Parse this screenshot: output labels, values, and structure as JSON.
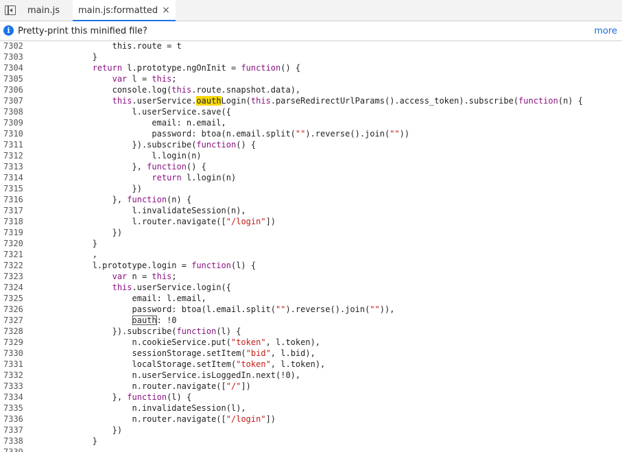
{
  "tabs": [
    {
      "label": "main.js",
      "active": false
    },
    {
      "label": "main.js:formatted",
      "active": true,
      "close": "×"
    }
  ],
  "infobar": {
    "message": "Pretty-print this minified file?",
    "more": "more",
    "icon": "info-icon"
  },
  "colors": {
    "keyword": "#881280",
    "string": "#c41a16",
    "search_highlight": "#f5d90a",
    "active_tab_accent": "#1a73e8"
  },
  "code_lines": [
    {
      "n": "7302",
      "s": [
        [
          "p",
          "                this.route = t"
        ]
      ]
    },
    {
      "n": "7303",
      "s": [
        [
          "p",
          "            }"
        ]
      ]
    },
    {
      "n": "7304",
      "s": [
        [
          "p",
          "            "
        ],
        [
          "k",
          "return"
        ],
        [
          "p",
          " l.prototype.ngOnInit = "
        ],
        [
          "k",
          "function"
        ],
        [
          "p",
          "() {"
        ]
      ]
    },
    {
      "n": "7305",
      "s": [
        [
          "p",
          "                "
        ],
        [
          "k",
          "var"
        ],
        [
          "p",
          " l = "
        ],
        [
          "k",
          "this"
        ],
        [
          "p",
          ";"
        ]
      ]
    },
    {
      "n": "7306",
      "s": [
        [
          "p",
          "                console.log("
        ],
        [
          "k",
          "this"
        ],
        [
          "p",
          ".route.snapshot.data),"
        ]
      ]
    },
    {
      "n": "7307",
      "s": [
        [
          "p",
          "                "
        ],
        [
          "k",
          "this"
        ],
        [
          "p",
          ".userService."
        ],
        [
          "h",
          "oauth"
        ],
        [
          "p",
          "Login("
        ],
        [
          "k",
          "this"
        ],
        [
          "p",
          ".parseRedirectUrlParams().access_token).subscribe("
        ],
        [
          "k",
          "function"
        ],
        [
          "p",
          "(n) {"
        ]
      ]
    },
    {
      "n": "7308",
      "s": [
        [
          "p",
          "                    l.userService.save({"
        ]
      ]
    },
    {
      "n": "7309",
      "s": [
        [
          "p",
          "                        email: n.email,"
        ]
      ]
    },
    {
      "n": "7310",
      "s": [
        [
          "p",
          "                        password: btoa(n.email.split("
        ],
        [
          "s",
          "\"\""
        ],
        [
          "p",
          ").reverse().join("
        ],
        [
          "s",
          "\"\""
        ],
        [
          "p",
          "))"
        ]
      ]
    },
    {
      "n": "7311",
      "s": [
        [
          "p",
          "                    }).subscribe("
        ],
        [
          "k",
          "function"
        ],
        [
          "p",
          "() {"
        ]
      ]
    },
    {
      "n": "7312",
      "s": [
        [
          "p",
          "                        l.login(n)"
        ]
      ]
    },
    {
      "n": "7313",
      "s": [
        [
          "p",
          "                    }, "
        ],
        [
          "k",
          "function"
        ],
        [
          "p",
          "() {"
        ]
      ]
    },
    {
      "n": "7314",
      "s": [
        [
          "p",
          "                        "
        ],
        [
          "k",
          "return"
        ],
        [
          "p",
          " l.login(n)"
        ]
      ]
    },
    {
      "n": "7315",
      "s": [
        [
          "p",
          "                    })"
        ]
      ]
    },
    {
      "n": "7316",
      "s": [
        [
          "p",
          "                }, "
        ],
        [
          "k",
          "function"
        ],
        [
          "p",
          "(n) {"
        ]
      ]
    },
    {
      "n": "7317",
      "s": [
        [
          "p",
          "                    l.invalidateSession(n),"
        ]
      ]
    },
    {
      "n": "7318",
      "s": [
        [
          "p",
          "                    l.router.navigate(["
        ],
        [
          "s",
          "\"/login\""
        ],
        [
          "p",
          "])"
        ]
      ]
    },
    {
      "n": "7319",
      "s": [
        [
          "p",
          "                })"
        ]
      ]
    },
    {
      "n": "7320",
      "s": [
        [
          "p",
          "            }"
        ]
      ]
    },
    {
      "n": "7321",
      "s": [
        [
          "p",
          "            ,"
        ]
      ]
    },
    {
      "n": "7322",
      "s": [
        [
          "p",
          "            l.prototype.login = "
        ],
        [
          "k",
          "function"
        ],
        [
          "p",
          "(l) {"
        ]
      ]
    },
    {
      "n": "7323",
      "s": [
        [
          "p",
          "                "
        ],
        [
          "k",
          "var"
        ],
        [
          "p",
          " n = "
        ],
        [
          "k",
          "this"
        ],
        [
          "p",
          ";"
        ]
      ]
    },
    {
      "n": "7324",
      "s": [
        [
          "p",
          "                "
        ],
        [
          "k",
          "this"
        ],
        [
          "p",
          ".userService.login({"
        ]
      ]
    },
    {
      "n": "7325",
      "s": [
        [
          "p",
          "                    email: l.email,"
        ]
      ]
    },
    {
      "n": "7326",
      "s": [
        [
          "p",
          "                    password: btoa(l.email.split("
        ],
        [
          "s",
          "\"\""
        ],
        [
          "p",
          ").reverse().join("
        ],
        [
          "s",
          "\"\""
        ],
        [
          "p",
          ")),"
        ]
      ]
    },
    {
      "n": "7327",
      "s": [
        [
          "p",
          "                    "
        ],
        [
          "b",
          "oauth"
        ],
        [
          "p",
          ": !0"
        ]
      ]
    },
    {
      "n": "7328",
      "s": [
        [
          "p",
          "                }).subscribe("
        ],
        [
          "k",
          "function"
        ],
        [
          "p",
          "(l) {"
        ]
      ]
    },
    {
      "n": "7329",
      "s": [
        [
          "p",
          "                    n.cookieService.put("
        ],
        [
          "s",
          "\"token\""
        ],
        [
          "p",
          ", l.token),"
        ]
      ]
    },
    {
      "n": "7330",
      "s": [
        [
          "p",
          "                    sessionStorage.setItem("
        ],
        [
          "s",
          "\"bid\""
        ],
        [
          "p",
          ", l.bid),"
        ]
      ]
    },
    {
      "n": "7331",
      "s": [
        [
          "p",
          "                    localStorage.setItem("
        ],
        [
          "s",
          "\"token\""
        ],
        [
          "p",
          ", l.token),"
        ]
      ]
    },
    {
      "n": "7332",
      "s": [
        [
          "p",
          "                    n.userService.isLoggedIn.next(!0),"
        ]
      ]
    },
    {
      "n": "7333",
      "s": [
        [
          "p",
          "                    n.router.navigate(["
        ],
        [
          "s",
          "\"/\""
        ],
        [
          "p",
          "])"
        ]
      ]
    },
    {
      "n": "7334",
      "s": [
        [
          "p",
          "                }, "
        ],
        [
          "k",
          "function"
        ],
        [
          "p",
          "(l) {"
        ]
      ]
    },
    {
      "n": "7335",
      "s": [
        [
          "p",
          "                    n.invalidateSession(l),"
        ]
      ]
    },
    {
      "n": "7336",
      "s": [
        [
          "p",
          "                    n.router.navigate(["
        ],
        [
          "s",
          "\"/login\""
        ],
        [
          "p",
          "])"
        ]
      ]
    },
    {
      "n": "7337",
      "s": [
        [
          "p",
          "                })"
        ]
      ]
    },
    {
      "n": "7338",
      "s": [
        [
          "p",
          "            }"
        ]
      ]
    },
    {
      "n": "7339",
      "s": [
        [
          "p",
          ""
        ]
      ]
    }
  ]
}
